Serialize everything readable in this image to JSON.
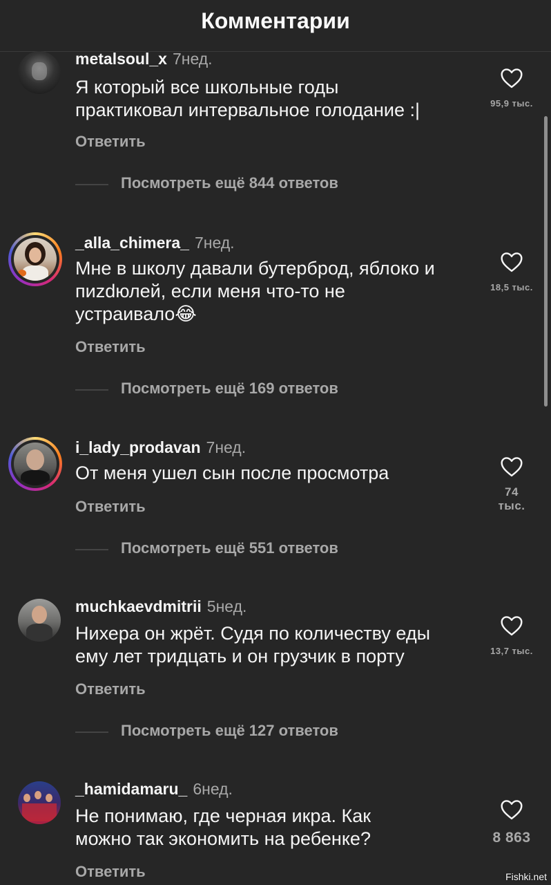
{
  "header": {
    "title": "Комментарии"
  },
  "comments": [
    {
      "username": "metalsoul_x",
      "time": "7нед.",
      "text_lines": [
        "Я который все школьные годы",
        "практиковал интервальное голодание :|"
      ],
      "reply_label": "Ответить",
      "likes": "95,9 тыс.",
      "more_replies": "Посмотреть ещё 844 ответов"
    },
    {
      "username": "_alla_chimera_",
      "time": "7нед.",
      "text_lines": [
        "Мне в школу давали бутерброд, яблоко и",
        "пиzdюлей, если меня что-то не",
        "устраивало😂"
      ],
      "reply_label": "Ответить",
      "likes": "18,5 тыс.",
      "more_replies": "Посмотреть ещё 169 ответов"
    },
    {
      "username": "i_lady_prodavan",
      "time": "7нед.",
      "text_lines": [
        "От меня ушел сын после просмотра"
      ],
      "reply_label": "Ответить",
      "likes": "74 тыс.",
      "more_replies": "Посмотреть ещё 551 ответов"
    },
    {
      "username": "muchkaevdmitrii",
      "time": "5нед.",
      "text_lines": [
        "Нихера он жрёт. Судя по количеству еды",
        "ему лет тридцать и он грузчик в порту"
      ],
      "reply_label": "Ответить",
      "likes": "13,7 тыс.",
      "more_replies": "Посмотреть ещё 127 ответов"
    },
    {
      "username": "_hamidamaru_",
      "time": "6нед.",
      "text_lines": [
        "Не понимаю, где черная икра. Как",
        "можно так экономить на ребенке?"
      ],
      "reply_label": "Ответить",
      "likes": "8 863"
    }
  ],
  "watermark": "Fishki.net",
  "colors": {
    "background": "#262626",
    "text": "#f5f5f5",
    "secondary": "#a8a8a8"
  }
}
